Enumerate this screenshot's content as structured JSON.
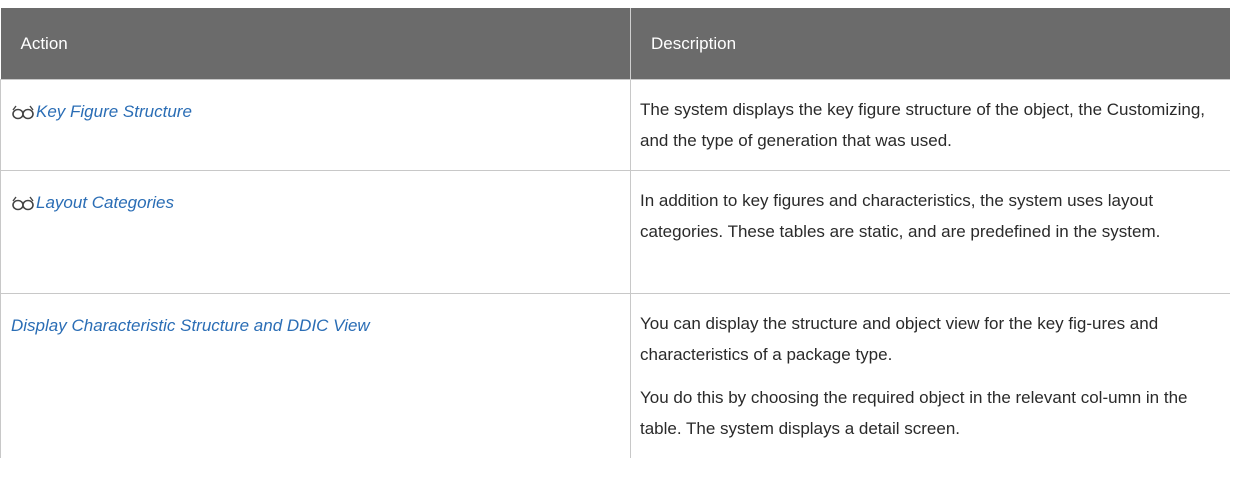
{
  "table": {
    "headers": {
      "action": "Action",
      "description": "Description"
    },
    "rows": [
      {
        "action": "Key Figure Structure",
        "action_icon": "glasses-icon",
        "description": [
          "The system displays the key figure structure of the object, the Customizing, and the type of generation that was used."
        ]
      },
      {
        "action": "Layout Categories",
        "action_icon": "glasses-icon",
        "description": [
          "In addition to key figures and characteristics, the system uses layout categories. These tables are static, and are predefined in the system."
        ]
      },
      {
        "action": "Display Characteristic Structure and DDIC View",
        "action_icon": "",
        "description": [
          "You can display the structure and object view for the key fig-ures and characteristics of a package type.",
          "You do this by choosing the required object in the relevant col-umn in the table. The system displays a detail screen."
        ]
      }
    ]
  },
  "colors": {
    "header_bg": "#6b6b6b",
    "link": "#2a6db5",
    "border": "#c8c8c8"
  }
}
